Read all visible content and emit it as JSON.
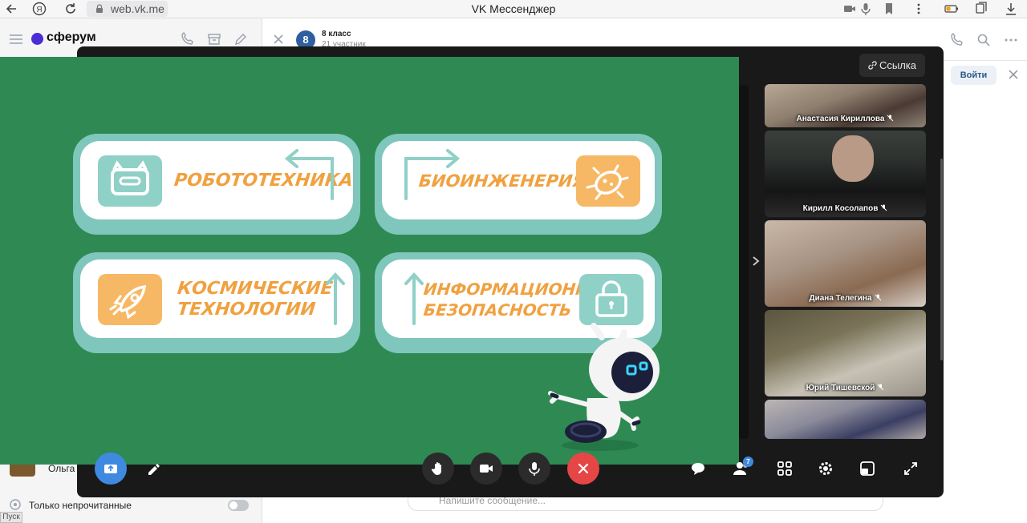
{
  "browser": {
    "url": "web.vk.me",
    "window_title": "VK Мессенджер"
  },
  "vk": {
    "logo": "сферум",
    "chat": {
      "avatar_letter": "8",
      "name": "8 класс",
      "subtitle": "21 участник"
    },
    "join_label": "Войти",
    "sidebar_contact": "Ольга",
    "unread_only": "Только непрочитанные",
    "message_placeholder": "Напишите сообщение...",
    "taskbar_start": "Пуск"
  },
  "call": {
    "link_button": "Ссылка",
    "slide": {
      "cards": [
        {
          "text": "РОБОТОТЕХНИКА",
          "icon": "robot-face-icon"
        },
        {
          "text": "БИОИНЖЕНЕРИЯ",
          "icon": "bacteria-icon"
        },
        {
          "text_line1": "КОСМИЧЕСКИЕ",
          "text_line2": "ТЕХНОЛОГИИ",
          "icon": "rocket-icon"
        },
        {
          "text_line1": "ИНФОРМАЦИОННАЯ",
          "text_line2": "БЕЗОПАСНОСТЬ",
          "icon": "padlock-icon"
        }
      ]
    },
    "participants": [
      {
        "name": "Анастасия Кириллова",
        "muted": true
      },
      {
        "name": "Кирилл Косолапов",
        "muted": true
      },
      {
        "name": "Диана Телегина",
        "muted": true
      },
      {
        "name": "Юрий Тишевской",
        "muted": true
      },
      {
        "name": "",
        "muted": false
      }
    ],
    "participants_count_badge": "7",
    "colors": {
      "slide_bg": "#2e8a52",
      "card_teal": "#7fc6bc",
      "card_text": "#f0a140",
      "end_call": "#e64646",
      "share_button": "#3f8ae0"
    }
  }
}
